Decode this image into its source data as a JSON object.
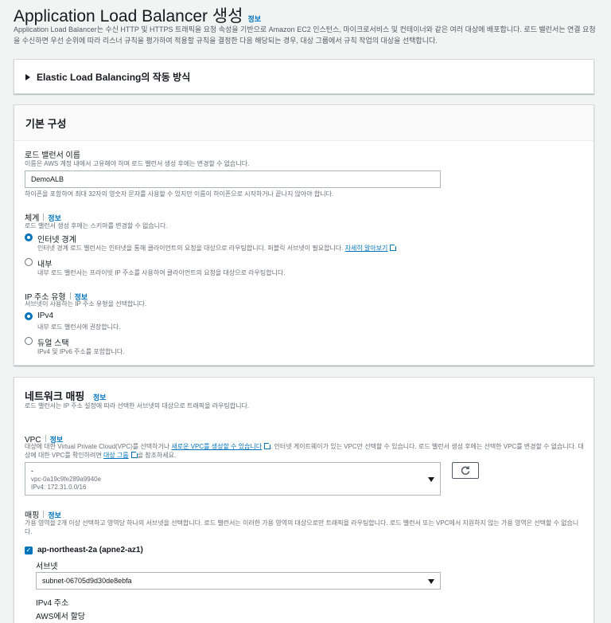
{
  "page": {
    "title": "Application Load Balancer 생성",
    "info": "정보",
    "description": "Application Load Balancer는 수신 HTTP 및 HTTPS 트래픽을 요청 속성을 기반으로 Amazon EC2 인스턴스, 마이크로서비스 및 컨테이너와 같은 여러 대상에 배포합니다. 로드 밸런서는 연결 요청을 수신하면 우선 순위에 따라 리스너 규칙을 평가하여 적용할 규칙을 결정한 다음 해당되는 경우, 대상 그룹에서 규칙 작업의 대상을 선택합니다."
  },
  "elb_section": {
    "label": "Elastic Load Balancing의 작동 방식"
  },
  "basic": {
    "heading": "기본 구성",
    "name_label": "로드 밸런서 이름",
    "name_desc": "이름은 AWS 계정 내에서 고유해야 하며 로드 밸런서 생성 후에는 변경할 수 없습니다.",
    "name_value": "DemoALB",
    "name_hint": "하이픈을 포함하여 최대 32자의 영숫자 문자를 사용할 수 있지만 이름이 하이픈으로 시작하거나 끝나지 않아야 합니다.",
    "scheme_label": "체계",
    "scheme_info": "정보",
    "scheme_desc": "로드 밸런서 생성 후에는 스키마를 변경할 수 없습니다.",
    "scheme_options": [
      {
        "label": "인터넷 경계",
        "desc": "인터넷 경계 로드 밸런서는 인터넷을 통해 클라이언트의 요청을 대상으로 라우팅합니다. 퍼블릭 서브넷이 필요합니다.",
        "link": "자세히 알아보기",
        "selected": true
      },
      {
        "label": "내부",
        "desc": "내부 로드 밸런서는 프라이빗 IP 주소를 사용하여 클라이언트의 요청을 대상으로 라우팅합니다.",
        "selected": false
      }
    ],
    "ip_label": "IP 주소 유형",
    "ip_info": "정보",
    "ip_desc": "서브넷이 사용하는 IP 주소 유형을 선택합니다.",
    "ip_options": [
      {
        "label": "IPv4",
        "desc": "내부 로드 밸런서에 권장합니다.",
        "selected": true
      },
      {
        "label": "듀얼 스택",
        "desc": "IPv4 및 IPv6 주소를 포함합니다.",
        "selected": false
      }
    ]
  },
  "network": {
    "heading": "네트워크 매핑",
    "info": "정보",
    "desc": "로드 밸런서는 IP 주소 설정에 따라 선택한 서브넷의 대상으로 트래픽을 라우팅합니다.",
    "vpc_label": "VPC",
    "vpc_info": "정보",
    "vpc_desc_1": "대상에 대한 Virtual Private Cloud(VPC)를 선택하거나",
    "vpc_desc_link1": "새로운 VPC를 생성할 수 있습니다",
    "vpc_desc_2": ". 인터넷 게이트웨이가 있는 VPC만 선택할 수 있습니다. 로드 밸런서 생성 후에는 선택한 VPC를 변경할 수 없습니다. 대상에 대한 VPC를 확인하려면",
    "vpc_desc_link2": "대상 그룹",
    "vpc_desc_3": "을 참조하세요.",
    "vpc_select": {
      "name": "-",
      "id": "vpc-0a19c9fe289a9940e",
      "cidr": "IPv4: 172.31.0.0/16"
    },
    "mapping_label": "매핑",
    "mapping_info": "정보",
    "mapping_desc": "가용 영역을 2개 이상 선택하고 영역당 하나의 서브넷을 선택합니다. 로드 밸런서는 이러한 가용 영역의 대상으로만 트래픽을 라우팅합니다. 로드 밸런서 또는 VPC에서 지원하지 않는 가용 영역은 선택할 수 없습니다.",
    "az": {
      "label": "ap-northeast-2a (apne2-az1)",
      "checked": true,
      "subnet_label": "서브넷",
      "subnet_value": "subnet-06705d9d30de8ebfa",
      "ipv4_label": "IPv4 주소",
      "ipv4_value": "AWS에서 할당"
    }
  }
}
